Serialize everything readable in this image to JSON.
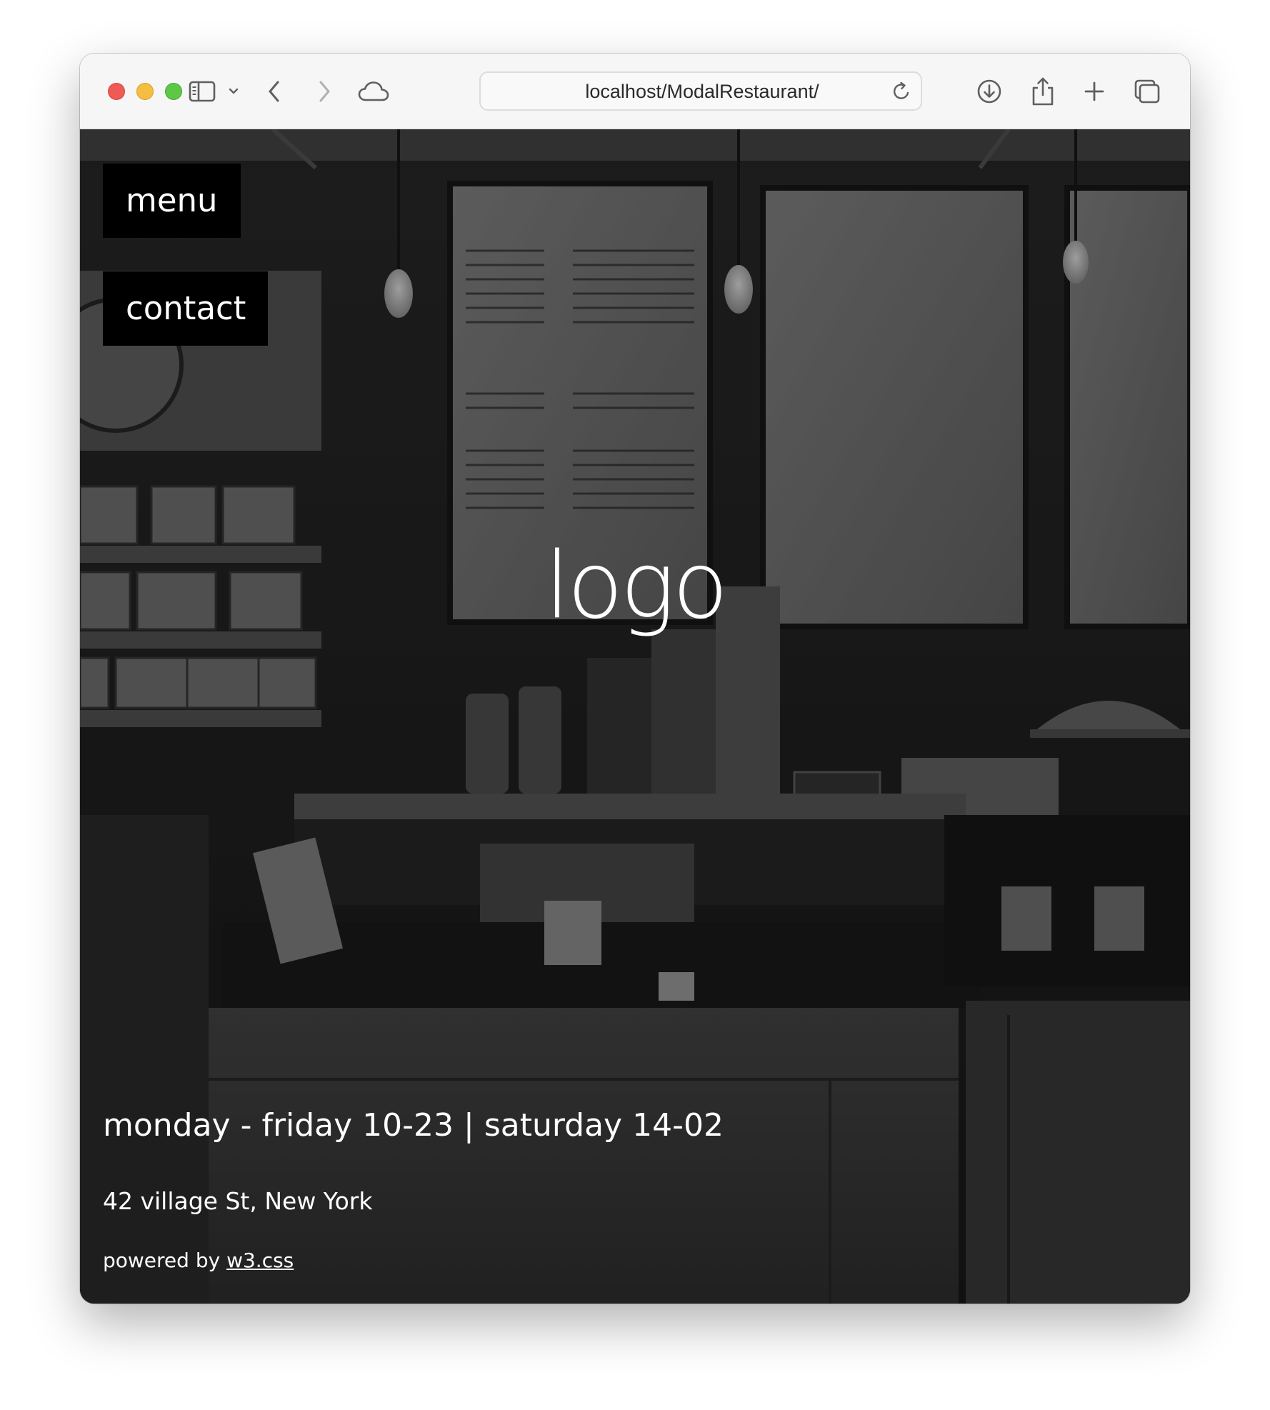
{
  "browser": {
    "url": "localhost/ModalRestaurant/",
    "icons": [
      "sidebar-icon",
      "chevron-down-icon",
      "back-icon",
      "forward-icon",
      "icloud-icon",
      "reload-icon",
      "download-icon",
      "share-icon",
      "new-tab-icon",
      "tab-overview-icon"
    ]
  },
  "page": {
    "nav": {
      "menu_label": "menu",
      "contact_label": "contact"
    },
    "logo_text": "logo",
    "hours": "monday - friday 10-23 | saturday 14-02",
    "address": "42 village St, New York",
    "powered_prefix": "powered by ",
    "powered_link": "w3.css"
  },
  "colors": {
    "button_bg": "#000000",
    "text": "#ffffff",
    "traffic_red": "#ee5b55",
    "traffic_yellow": "#f5bd41",
    "traffic_green": "#5ec846"
  }
}
